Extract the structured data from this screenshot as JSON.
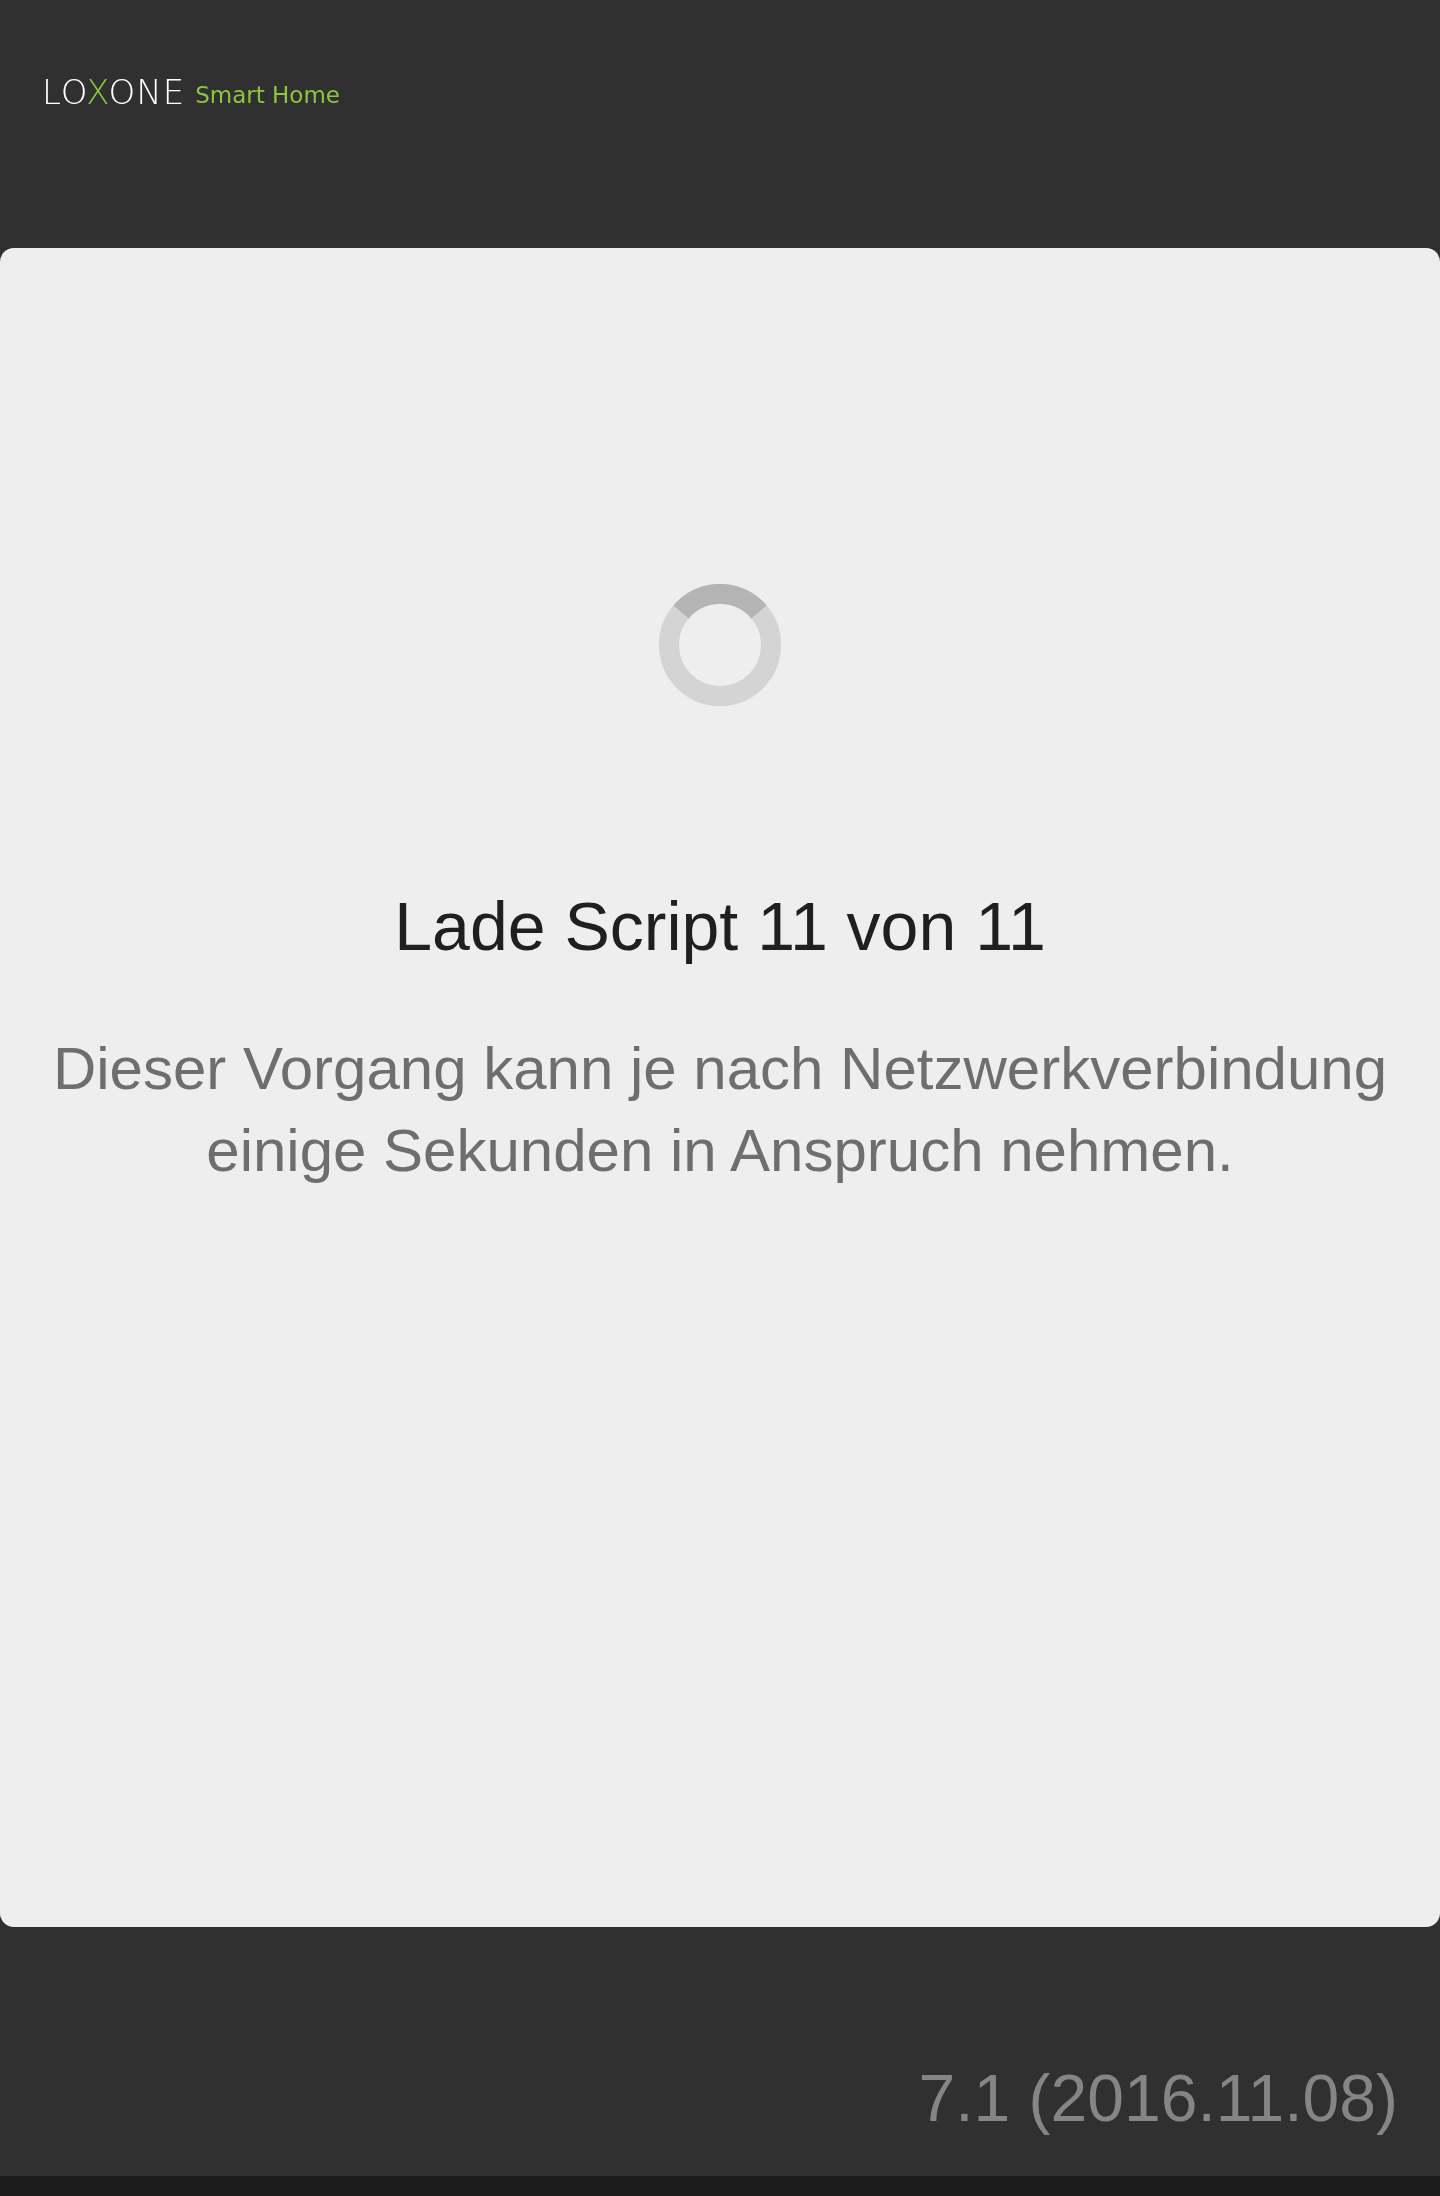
{
  "header": {
    "logo_parts": [
      {
        "text": "LO",
        "accent": false
      },
      {
        "text": "X",
        "accent": true
      },
      {
        "text": "ONE",
        "accent": false
      }
    ],
    "tagline": "Smart Home"
  },
  "loading_card": {
    "title": "Lade Script 11 von 11",
    "message": "Dieser Vorgang kann je nach Netzwerkverbindung einige Sekunden in Anspruch nehmen."
  },
  "version": "7.1 (2016.11.08)"
}
